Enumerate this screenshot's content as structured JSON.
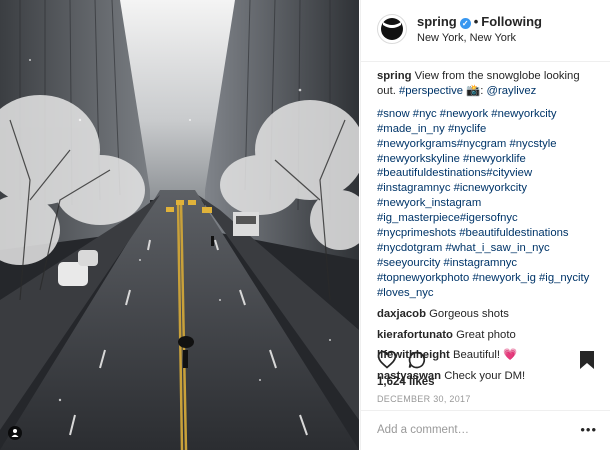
{
  "post": {
    "username": "spring",
    "follow_status": "Following",
    "location": "New York, New York",
    "caption": {
      "username": "spring",
      "text": "View from the snowglobe looking out.",
      "hashtag": "#perspective",
      "emoji": "📸",
      "credit": "@raylivez"
    },
    "tags": "#snow #nyc #newyork #newyorkcity #made_in_ny #nyclife #newyorkgrams#nycgram #nycstyle #newyorkskyline #newyorklife #beautifuldestinations#cityview #instagramnyc #icnewyorkcity #newyork_instagram #ig_masterpiece#igersofnyc #nycprimeshots #beautifuldestinations #nycdotgram #what_i_saw_in_nyc #seeyourcity #instagramnyc #topnewyorkphoto #newyork_ig #ig_nycity #loves_nyc",
    "comments": [
      {
        "username": "daxjacob",
        "text": "Gorgeous shots"
      },
      {
        "username": "kierafortunato",
        "text": "Great photo"
      },
      {
        "username": "lifewithheight",
        "text": "Beautiful! 💗"
      },
      {
        "username": "nastyaswan",
        "text": "Check your DM!"
      }
    ],
    "likes": "1,624 likes",
    "date": "DECEMBER 30, 2017",
    "add_comment_placeholder": "Add a comment…",
    "more_options": "•••"
  },
  "icons": [
    "verified-badge-icon",
    "heart-icon",
    "comment-icon",
    "bookmark-icon",
    "tag-person-icon",
    "more-options-icon"
  ],
  "colors": {
    "link": "#003569",
    "verified": "#3897f0",
    "muted": "#999999"
  }
}
